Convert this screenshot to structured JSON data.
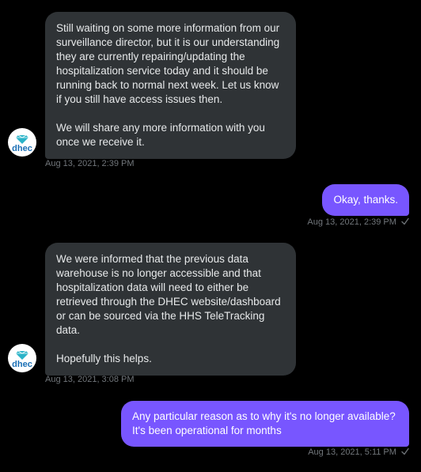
{
  "conversation": {
    "messages": [
      {
        "direction": "incoming",
        "paragraphs": [
          "Still waiting on some more information from our surveillance director, but it is our understanding they are currently repairing/updating the hospitalization service today and it should be running back to normal next week. Let us know if you still have access issues then.",
          "We will share any more information with you once we receive it."
        ],
        "timestamp": "Aug 13, 2021, 2:39 PM"
      },
      {
        "direction": "outgoing",
        "text": "Okay, thanks.",
        "timestamp": "Aug 13, 2021, 2:39 PM",
        "status_icon": "checkmark-icon"
      },
      {
        "direction": "incoming",
        "paragraphs": [
          "We were informed that the previous data warehouse is no longer accessible and that hospitalization data will need to either be retrieved through the DHEC website/dashboard or can be sourced via the HHS TeleTracking data.",
          "Hopefully this helps."
        ],
        "timestamp": "Aug 13, 2021, 3:08 PM"
      },
      {
        "direction": "outgoing",
        "text": "Any particular reason as to why it's no longer available? It's been operational for months",
        "timestamp": "Aug 13, 2021, 5:11 PM",
        "status_icon": "checkmark-icon"
      }
    ],
    "sender": {
      "avatar_text": "dhec",
      "avatar_icon": "dhec-logo-icon"
    }
  },
  "colors": {
    "background": "#000000",
    "incoming_bubble": "#2f3336",
    "outgoing_bubble": "#7856ff",
    "timestamp": "#71767b",
    "logo_blue": "#1a6fb5",
    "logo_teal": "#2ab3c8"
  }
}
